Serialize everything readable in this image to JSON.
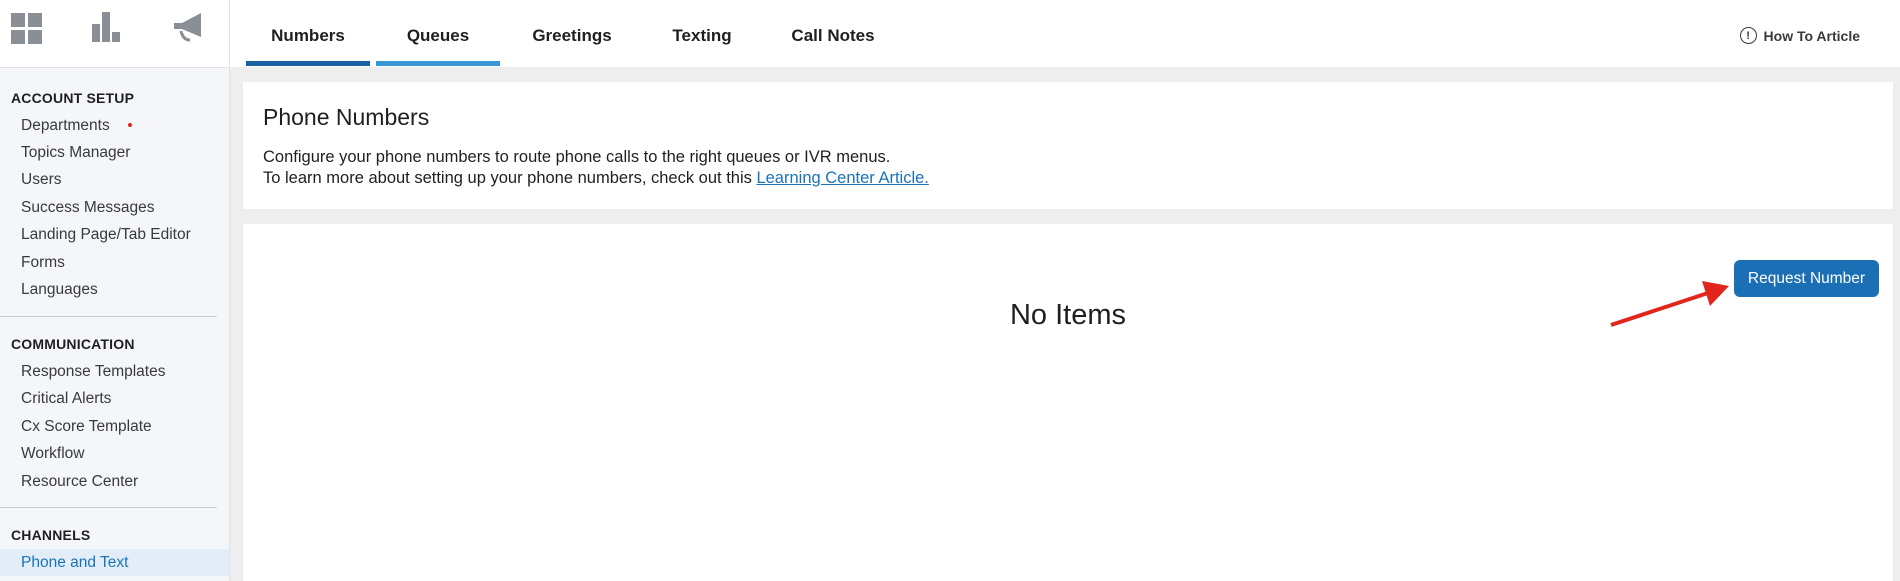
{
  "sidebar": {
    "top_icons": [
      "dashboard-icon",
      "bar-chart-icon",
      "megaphone-icon"
    ],
    "sections": [
      {
        "title": "ACCOUNT SETUP",
        "items": [
          {
            "label": "Departments"
          },
          {
            "label": "Topics Manager"
          },
          {
            "label": "Users"
          },
          {
            "label": "Success Messages"
          },
          {
            "label": "Landing Page/Tab Editor"
          },
          {
            "label": "Forms"
          },
          {
            "label": "Languages"
          }
        ]
      },
      {
        "title": "COMMUNICATION",
        "items": [
          {
            "label": "Response Templates"
          },
          {
            "label": "Critical Alerts"
          },
          {
            "label": "Cx Score Template"
          },
          {
            "label": "Workflow"
          },
          {
            "label": "Resource Center"
          }
        ]
      },
      {
        "title": "CHANNELS",
        "items": [
          {
            "label": "Phone and Text",
            "active": true
          }
        ]
      }
    ]
  },
  "tabs": [
    {
      "label": "Numbers",
      "active": true
    },
    {
      "label": "Queues"
    },
    {
      "label": "Greetings"
    },
    {
      "label": "Texting"
    },
    {
      "label": "Call Notes"
    }
  ],
  "howto": {
    "label": "How To Article",
    "icon": "!"
  },
  "phone_numbers": {
    "title": "Phone Numbers",
    "line1": "Configure your phone numbers to route phone calls to the right queues or IVR menus.",
    "line2_prefix": "To learn more about setting up your phone numbers, check out this ",
    "link_text": "Learning Center Article."
  },
  "list": {
    "empty_text": "No Items",
    "request_button": "Request Number"
  },
  "colors": {
    "accent": "#1b6fb5",
    "tab_active": "#1a5f9e",
    "tab_hover": "#3a97d6",
    "arrow": "#e1261c"
  }
}
